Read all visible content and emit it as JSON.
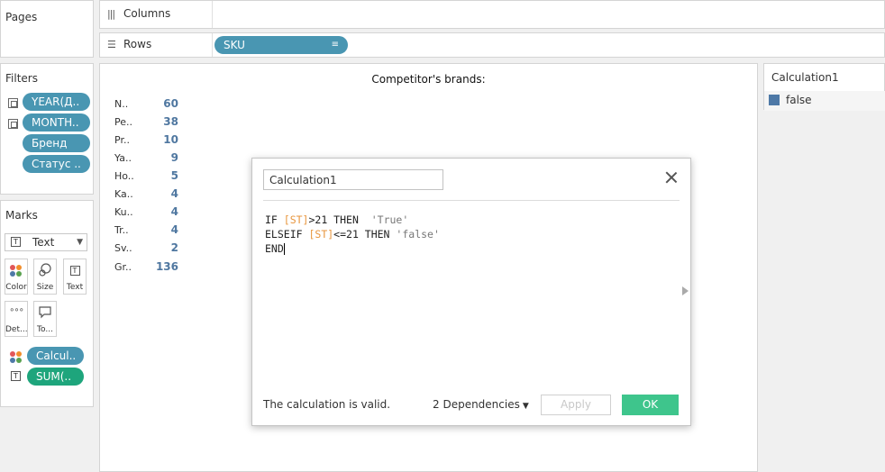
{
  "pages": {
    "title": "Pages"
  },
  "shelves": {
    "columns_label": "Columns",
    "rows_label": "Rows",
    "rows_pill": "SKU"
  },
  "filters": {
    "title": "Filters",
    "items": [
      "YEAR(Д..",
      "MONTH..",
      "Бренд",
      "Статус .."
    ]
  },
  "marks": {
    "title": "Marks",
    "type": "Text",
    "buttons": [
      "Color",
      "Size",
      "Text",
      "Det...",
      "To..."
    ],
    "pills": [
      "Calcul..",
      "SUM(.."
    ]
  },
  "view": {
    "title": "Competitor's brands:",
    "rows": [
      {
        "label": "N..",
        "value": "60"
      },
      {
        "label": "Pe..",
        "value": "38"
      },
      {
        "label": "Pr..",
        "value": "10"
      },
      {
        "label": "Ya..",
        "value": "9"
      },
      {
        "label": "Ho..",
        "value": "5"
      },
      {
        "label": "Ka..",
        "value": "4"
      },
      {
        "label": "Ku..",
        "value": "4"
      },
      {
        "label": "Tr..",
        "value": "4"
      },
      {
        "label": "Sv..",
        "value": "2"
      },
      {
        "label": "Gr..",
        "value": "136"
      }
    ]
  },
  "legend": {
    "title": "Calculation1",
    "item_label": "false",
    "item_color": "#4e79a7"
  },
  "dialog": {
    "name": "Calculation1",
    "code": {
      "l1_kw": "IF ",
      "l1_field": "[ST]",
      "l1_rest": ">21 THEN  ",
      "l1_str": "'True'",
      "l2_kw": "ELSEIF ",
      "l2_field": "[ST]",
      "l2_rest": "<=21 THEN ",
      "l2_str": "'false'",
      "l3": "END"
    },
    "status": "The calculation is valid.",
    "dependencies": "2 Dependencies",
    "apply_label": "Apply",
    "ok_label": "OK"
  }
}
